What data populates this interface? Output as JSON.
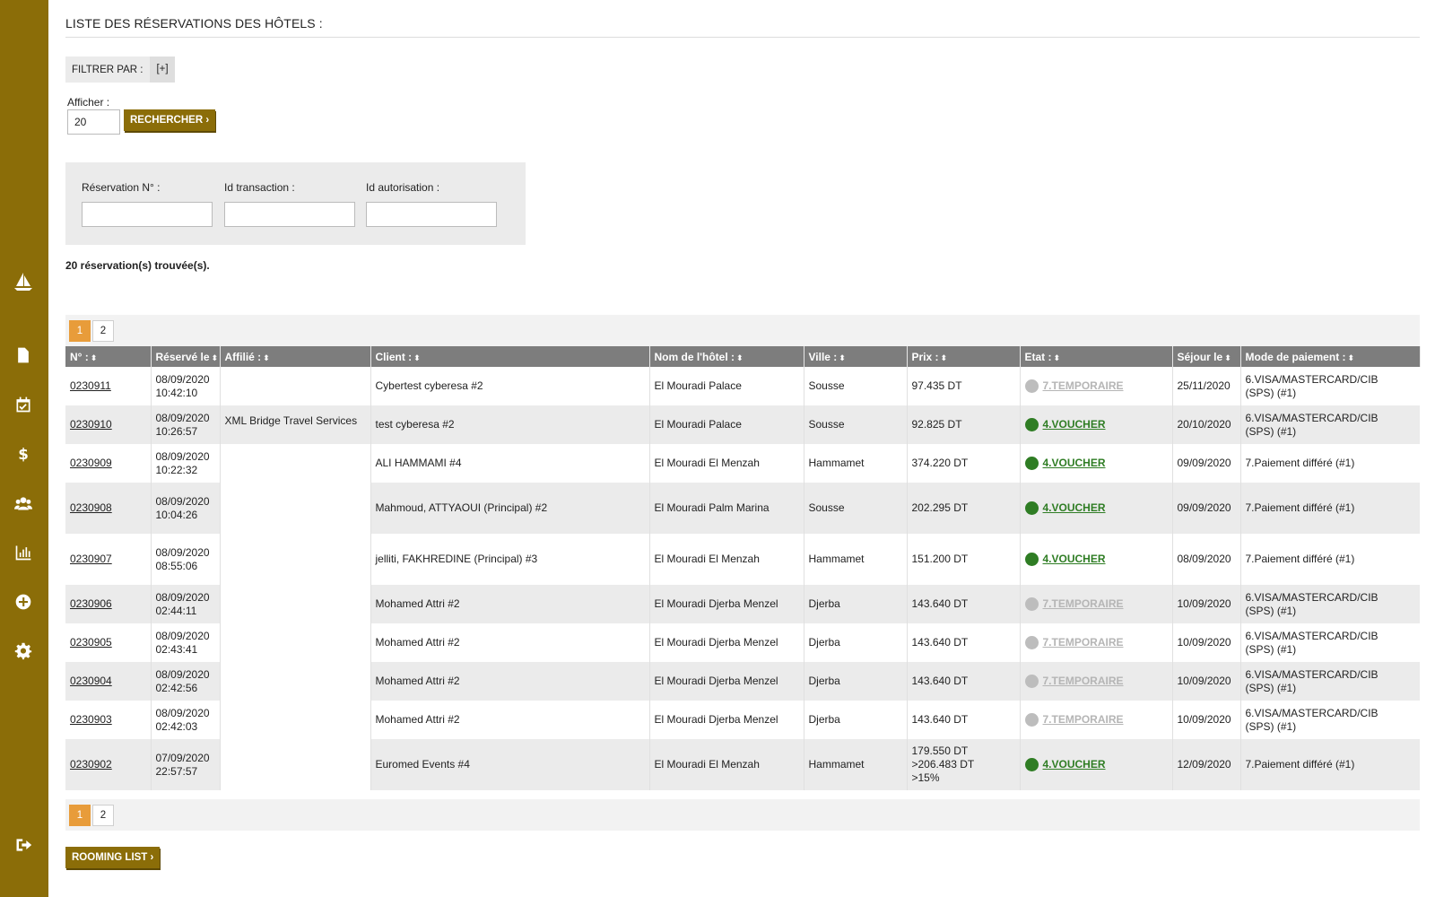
{
  "sidebar": {
    "items": [
      {
        "name": "sailboat-icon"
      },
      {
        "name": "document-icon"
      },
      {
        "name": "calendar-check-icon"
      },
      {
        "name": "dollar-icon"
      },
      {
        "name": "users-icon"
      },
      {
        "name": "bar-chart-icon"
      },
      {
        "name": "plus-circle-icon"
      },
      {
        "name": "gear-icon"
      },
      {
        "name": "logout-icon"
      }
    ]
  },
  "header": {
    "title": "LISTE DES RÉSERVATIONS DES HÔTELS :"
  },
  "filter": {
    "label": "FILTRER PAR :",
    "toggle": "[+]"
  },
  "display": {
    "label": "Afficher :",
    "value": "20",
    "search_button": "RECHERCHER ›"
  },
  "search_panel": {
    "reservation_label": "Réservation N° :",
    "transaction_label": "Id transaction :",
    "authorization_label": "Id autorisation :"
  },
  "results": {
    "found_text": "20 réservation(s) trouvée(s)."
  },
  "pagination": {
    "pages": [
      "1",
      "2"
    ],
    "current": "1"
  },
  "table": {
    "columns": [
      "N° :",
      "Réservé le",
      "Affilié :",
      "Client :",
      "Nom de l'hôtel :",
      "Ville :",
      "Prix :",
      "Etat :",
      "Séjour le",
      "Mode de paiement :"
    ],
    "sort_glyph": "⬍",
    "rows": [
      {
        "num": "0230911",
        "date": "08/09/2020",
        "time": "10:42:10",
        "affil": "",
        "client": "Cybertest cyberesa #2",
        "hotel": "El Mouradi Palace",
        "ville": "Sousse",
        "prix": [
          "97.435 DT"
        ],
        "etat": "7.TEMPORAIRE",
        "etat_status": "grey",
        "sejour": "25/11/2020",
        "paiement": [
          "6.VISA/MASTERCARD/CIB",
          "(SPS) (#1)"
        ]
      },
      {
        "num": "0230910",
        "date": "08/09/2020",
        "time": "10:26:57",
        "affil": "XML Bridge Travel Services",
        "client": "test cyberesa #2",
        "hotel": "El Mouradi Palace",
        "ville": "Sousse",
        "prix": [
          "92.825 DT"
        ],
        "etat": "4.VOUCHER",
        "etat_status": "green",
        "sejour": "20/10/2020",
        "paiement": [
          "6.VISA/MASTERCARD/CIB",
          "(SPS) (#1)"
        ]
      },
      {
        "num": "0230909",
        "date": "08/09/2020",
        "time": "10:22:32",
        "affil": "",
        "client": "ALI HAMMAMI #4",
        "hotel": "El Mouradi El Menzah",
        "ville": "Hammamet",
        "prix": [
          "374.220 DT"
        ],
        "etat": "4.VOUCHER",
        "etat_status": "green",
        "sejour": "09/09/2020",
        "paiement": [
          "7.Paiement différé (#1)"
        ]
      },
      {
        "num": "0230908",
        "date": "08/09/2020",
        "time": "10:04:26",
        "affil": "",
        "client": "Mahmoud, ATTYAOUI (Principal) #2",
        "hotel": "El Mouradi Palm Marina",
        "ville": "Sousse",
        "prix": [
          "202.295 DT"
        ],
        "etat": "4.VOUCHER",
        "etat_status": "green",
        "sejour": "09/09/2020",
        "paiement": [
          "7.Paiement différé (#1)"
        ]
      },
      {
        "num": "0230907",
        "date": "08/09/2020",
        "time": "08:55:06",
        "affil": "",
        "client": "jelliti, FAKHREDINE (Principal) #3",
        "hotel": "El Mouradi El Menzah",
        "ville": "Hammamet",
        "prix": [
          "151.200 DT"
        ],
        "etat": "4.VOUCHER",
        "etat_status": "green",
        "sejour": "08/09/2020",
        "paiement": [
          "7.Paiement différé (#1)"
        ]
      },
      {
        "num": "0230906",
        "date": "08/09/2020",
        "time": "02:44:11",
        "affil": "",
        "client": "Mohamed Attri #2",
        "hotel": "El Mouradi Djerba Menzel",
        "ville": "Djerba",
        "prix": [
          "143.640 DT"
        ],
        "etat": "7.TEMPORAIRE",
        "etat_status": "grey",
        "sejour": "10/09/2020",
        "paiement": [
          "6.VISA/MASTERCARD/CIB",
          "(SPS) (#1)"
        ]
      },
      {
        "num": "0230905",
        "date": "08/09/2020",
        "time": "02:43:41",
        "affil": "",
        "client": "Mohamed Attri #2",
        "hotel": "El Mouradi Djerba Menzel",
        "ville": "Djerba",
        "prix": [
          "143.640 DT"
        ],
        "etat": "7.TEMPORAIRE",
        "etat_status": "grey",
        "sejour": "10/09/2020",
        "paiement": [
          "6.VISA/MASTERCARD/CIB",
          "(SPS) (#1)"
        ]
      },
      {
        "num": "0230904",
        "date": "08/09/2020",
        "time": "02:42:56",
        "affil": "",
        "client": "Mohamed Attri #2",
        "hotel": "El Mouradi Djerba Menzel",
        "ville": "Djerba",
        "prix": [
          "143.640 DT"
        ],
        "etat": "7.TEMPORAIRE",
        "etat_status": "grey",
        "sejour": "10/09/2020",
        "paiement": [
          "6.VISA/MASTERCARD/CIB",
          "(SPS) (#1)"
        ]
      },
      {
        "num": "0230903",
        "date": "08/09/2020",
        "time": "02:42:03",
        "affil": "",
        "client": "Mohamed Attri #2",
        "hotel": "El Mouradi Djerba Menzel",
        "ville": "Djerba",
        "prix": [
          "143.640 DT"
        ],
        "etat": "7.TEMPORAIRE",
        "etat_status": "grey",
        "sejour": "10/09/2020",
        "paiement": [
          "6.VISA/MASTERCARD/CIB",
          "(SPS) (#1)"
        ]
      },
      {
        "num": "0230902",
        "date": "07/09/2020",
        "time": "22:57:57",
        "affil": "",
        "client": "Euromed Events #4",
        "hotel": "El Mouradi El Menzah",
        "ville": "Hammamet",
        "prix": [
          "179.550 DT",
          ">206.483 DT",
          ">15%"
        ],
        "etat": "4.VOUCHER",
        "etat_status": "green",
        "sejour": "12/09/2020",
        "paiement": [
          "7.Paiement différé (#1)"
        ]
      }
    ]
  },
  "footer": {
    "rooming_button": "ROOMING LIST ›"
  },
  "colors": {
    "brand_gold": "#8b6d08",
    "active_page": "#e89c3a",
    "voucher_green": "#2f7d24",
    "temporaire_grey": "#bdbdbd",
    "header_grey": "#7d7d7d"
  }
}
